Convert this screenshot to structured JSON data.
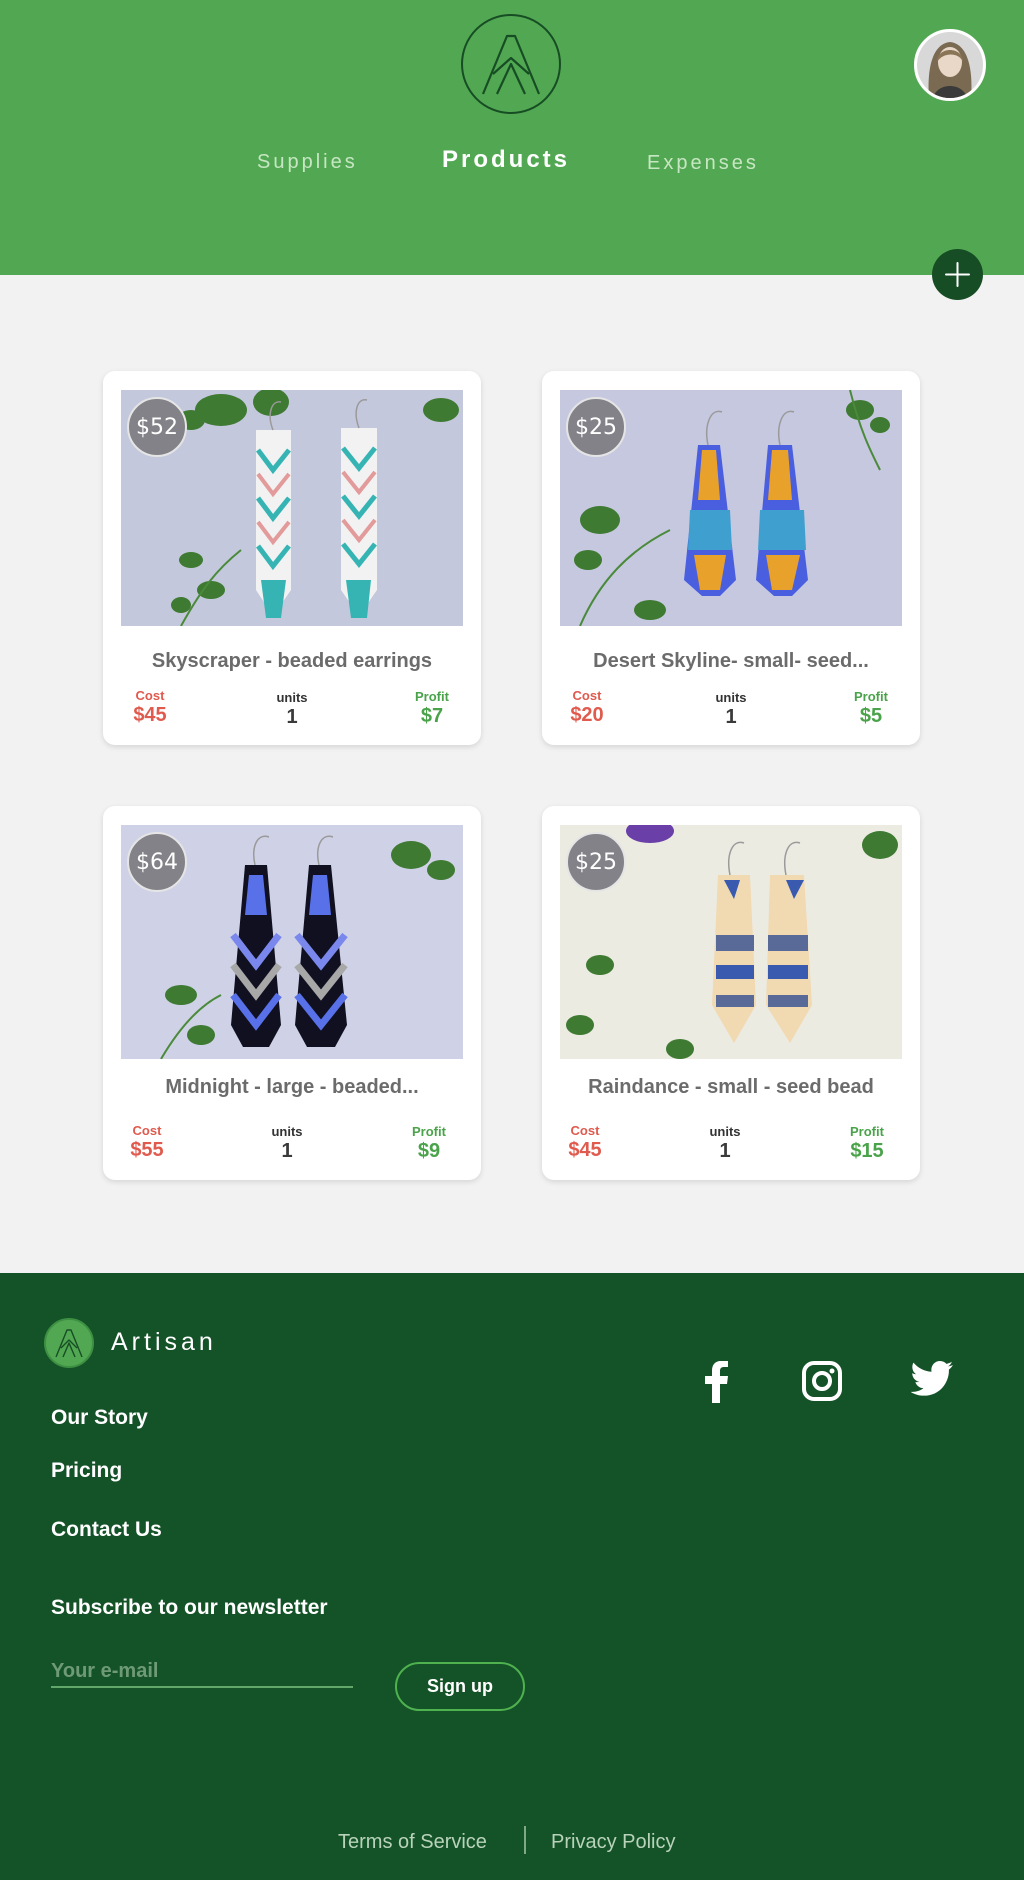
{
  "nav": {
    "supplies": "Supplies",
    "products": "Products",
    "expenses": "Expenses"
  },
  "products": [
    {
      "price": "$52",
      "title": "Skyscraper - beaded earrings",
      "cost_label": "Cost",
      "cost": "$45",
      "units_label": "units",
      "units": "1",
      "profit_label": "Profit",
      "profit": "$7"
    },
    {
      "price": "$25",
      "title": "Desert Skyline- small- seed...",
      "cost_label": "Cost",
      "cost": "$20",
      "units_label": "units",
      "units": "1",
      "profit_label": "Profit",
      "profit": "$5"
    },
    {
      "price": "$64",
      "title": "Midnight - large - beaded...",
      "cost_label": "Cost",
      "cost": "$55",
      "units_label": "units",
      "units": "1",
      "profit_label": "Profit",
      "profit": "$9"
    },
    {
      "price": "$25",
      "title": "Raindance - small - seed bead",
      "cost_label": "Cost",
      "cost": "$45",
      "units_label": "units",
      "units": "1",
      "profit_label": "Profit",
      "profit": "$15"
    }
  ],
  "footer": {
    "brand": "Artisan",
    "links": [
      "Our Story",
      "Pricing",
      "Contact Us"
    ],
    "newsletter_title": "Subscribe to our newsletter",
    "email_placeholder": "Your e-mail",
    "signup_label": "Sign up",
    "social_icons": [
      "facebook-icon",
      "instagram-icon",
      "twitter-icon"
    ],
    "terms": "Terms of Service",
    "privacy": "Privacy Policy"
  },
  "colors": {
    "header_green": "#52a852",
    "footer_green": "#145228",
    "cost_red": "#e05a4e",
    "profit_green": "#4aa34a"
  }
}
